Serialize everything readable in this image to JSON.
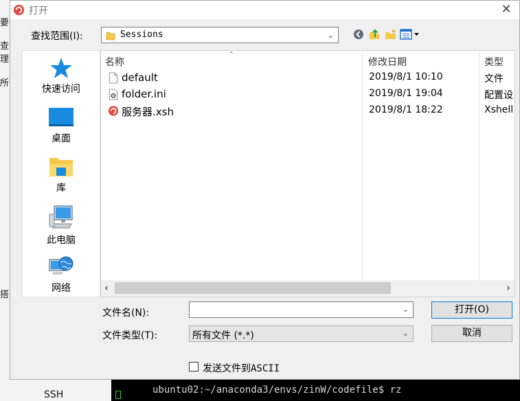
{
  "window": {
    "title": "打开",
    "close_symbol": "✕"
  },
  "lookin": {
    "label": "查找范围(I):",
    "value": "Sessions"
  },
  "places": [
    {
      "label": "快速访问"
    },
    {
      "label": "桌面"
    },
    {
      "label": "库"
    },
    {
      "label": "此电脑"
    },
    {
      "label": "网络"
    }
  ],
  "columns": {
    "name": "名称",
    "modified": "修改日期",
    "type": "类型"
  },
  "files": [
    {
      "name": "default",
      "modified": "2019/8/1 10:10",
      "type": "文件",
      "icon": "blank-file-icon"
    },
    {
      "name": "folder.ini",
      "modified": "2019/8/1 19:04",
      "type": "配置设",
      "icon": "config-file-icon"
    },
    {
      "name": "服务器.xsh",
      "modified": "2019/8/1 18:22",
      "type": "Xshell",
      "icon": "xshell-session-icon"
    }
  ],
  "filename": {
    "label": "文件名(N):",
    "value": ""
  },
  "filetype": {
    "label": "文件类型(T):",
    "value": "所有文件 (*.*)"
  },
  "buttons": {
    "open": "打开(O)",
    "cancel": "取消"
  },
  "ascii_checkbox": {
    "label": "发送文件到ASCII",
    "checked": false
  },
  "background": {
    "left_fragments": [
      "要",
      "查理",
      "所",
      "搭"
    ],
    "left_bottom": "SSH",
    "terminal_prompt": "ubuntu02:~/anaconda3/envs/zinW/codefile$ rz"
  },
  "colors": {
    "accent": "#0078d7",
    "xshell_red": "#e0463a",
    "folder_yellow": "#f5c84c"
  }
}
